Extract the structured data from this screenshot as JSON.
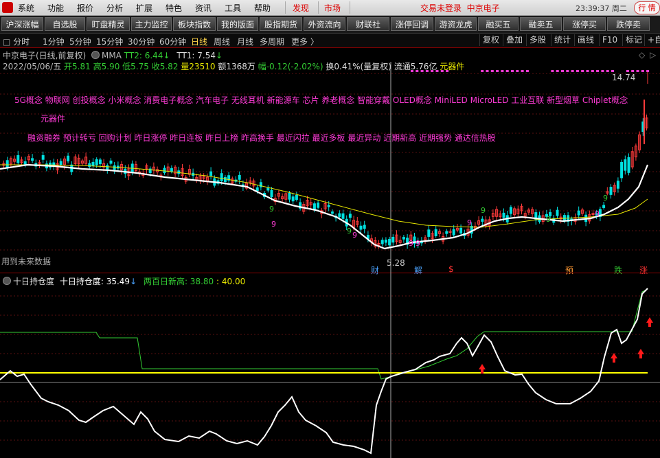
{
  "menubar": {
    "items": [
      "系统",
      "功能",
      "报价",
      "分析",
      "扩展",
      "特色",
      "资讯",
      "工具",
      "帮助"
    ],
    "discover": "发现",
    "market": "市场",
    "status": "交易未登录",
    "stock": "中京电子",
    "clock": "23:39:37 周二",
    "window_btn": "行 情"
  },
  "toolbar": {
    "buttons": [
      "沪深涨幅",
      "自选股",
      "盯盘精灵",
      "主力监控",
      "板块指数",
      "我的版面",
      "股指期货",
      "外资流向",
      "财联社",
      "涨停回调",
      "游资龙虎",
      "融买五",
      "融卖五",
      "涨停买",
      "跌停卖"
    ]
  },
  "periods": {
    "items": [
      "分时",
      "1分钟",
      "5分钟",
      "15分钟",
      "30分钟",
      "60分钟",
      "日线",
      "周线",
      "月线",
      "多周期",
      "更多 〉"
    ],
    "active_index": 6,
    "right": [
      "复权",
      "叠加",
      "多股",
      "统计",
      "画线",
      "F10",
      "标记",
      "+自"
    ]
  },
  "header": {
    "title": "中京电子(日线,前复权)",
    "indicator": "MMA",
    "tt2": "TT2: 6.44",
    "tt1": "TT1: 7.54",
    "date": "2022/05/06/五",
    "open": "开5.81",
    "high": "高5.90",
    "low": "低5.75",
    "close": "收5.82",
    "volume": "量23510",
    "amount": "额1368万",
    "change": "幅-0.12(-2.02%)",
    "turnover": "换0.41%(量复权)",
    "float": "流通5.76亿",
    "sector": "元器件"
  },
  "concepts": {
    "line1": "5G概念 物联网 创投概念 小米概念 消费电子概念 汽车电子 无线耳机 新能源车 芯片 养老概念 智能穿戴 OLED概念 MiniLED MicroLED 工业互联 新型烟草 Chiplet概念",
    "line2": "元器件",
    "line3": "融资融券 预计转亏 回购计划 昨日涨停 昨日连板 昨日上榜 昨高换手 最近闪拉 最近多板 最近异动 近期新高 近期强势 通达信热股"
  },
  "price_labels": {
    "high": "14.74",
    "low": "5.28",
    "future_note": "用到未来数据"
  },
  "event_tags": [
    {
      "text": "财",
      "color": "#4aa3ff"
    },
    {
      "text": "解",
      "color": "#4aa3ff"
    },
    {
      "text": "$",
      "color": "#ff3333"
    },
    {
      "text": "预",
      "color": "#ff9933"
    },
    {
      "text": "跌",
      "color": "#33cc33"
    },
    {
      "text": "涨",
      "color": "#ff3333"
    }
  ],
  "sub": {
    "name": "十日持仓度",
    "value_label": "十日持仓度: 35.49",
    "high_label": "两百日新高: 38.80",
    "extra": ": 40.00"
  },
  "colors": {
    "up": "#ff3b3b",
    "down": "#00e0e0",
    "ma_white": "#ffffff",
    "ma_yellow": "#e6e600",
    "concept": "#ff3bd6",
    "grid": "#5a1010",
    "green_line": "#33cc33"
  },
  "chart_data": {
    "type": "line",
    "series": [
      {
        "name": "TT2",
        "values": [
          6.44
        ]
      },
      {
        "name": "TT1",
        "values": [
          7.54
        ]
      },
      {
        "name": "十日持仓度",
        "values": [
          35.49
        ]
      },
      {
        "name": "两百日新高",
        "values": [
          38.8
        ]
      }
    ],
    "ymax_visible": 14.74,
    "ymin_visible": 5.28
  }
}
